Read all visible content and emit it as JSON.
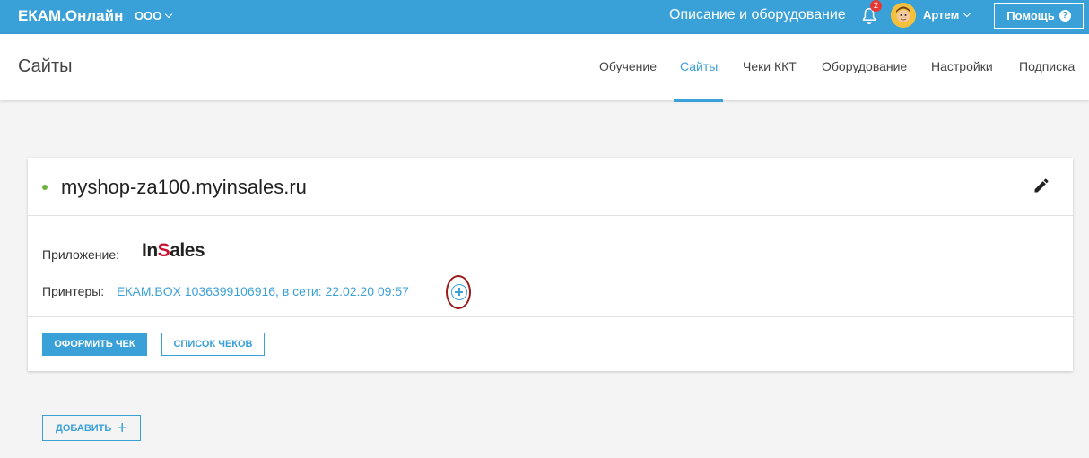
{
  "topbar": {
    "brand": "ЕКАМ.Онлайн",
    "org": "ООО",
    "link": "Описание и оборудование",
    "notification_count": "2",
    "user_name": "Артем",
    "help_label": "Помощь",
    "help_icon": "?"
  },
  "header": {
    "title": "Сайты",
    "nav": [
      {
        "label": "Обучение",
        "active": false
      },
      {
        "label": "Сайты",
        "active": true
      },
      {
        "label": "Чеки ККТ",
        "active": false
      },
      {
        "label": "Оборудование",
        "active": false
      },
      {
        "label": "Настройки",
        "active": false
      },
      {
        "label": "Подписка",
        "active": false
      }
    ]
  },
  "site": {
    "name": "myshop-za100.myinsales.ru",
    "app_label": "Приложение:",
    "app_logo_prefix": "In",
    "app_logo_s": "S",
    "app_logo_suffix": "ales",
    "printers_label": "Принтеры:",
    "printer_value": "ЕКАМ.BOX 1036399106916, в сети: 22.02.20 09:57",
    "issue_receipt_label": "ОФОРМИТЬ ЧЕК",
    "receipts_list_label": "СПИСОК ЧЕКОВ"
  },
  "add_label": "ДОБАВИТЬ",
  "colors": {
    "accent": "#3aa0d8",
    "status_online": "#6cb33f",
    "badge": "#e53935"
  }
}
